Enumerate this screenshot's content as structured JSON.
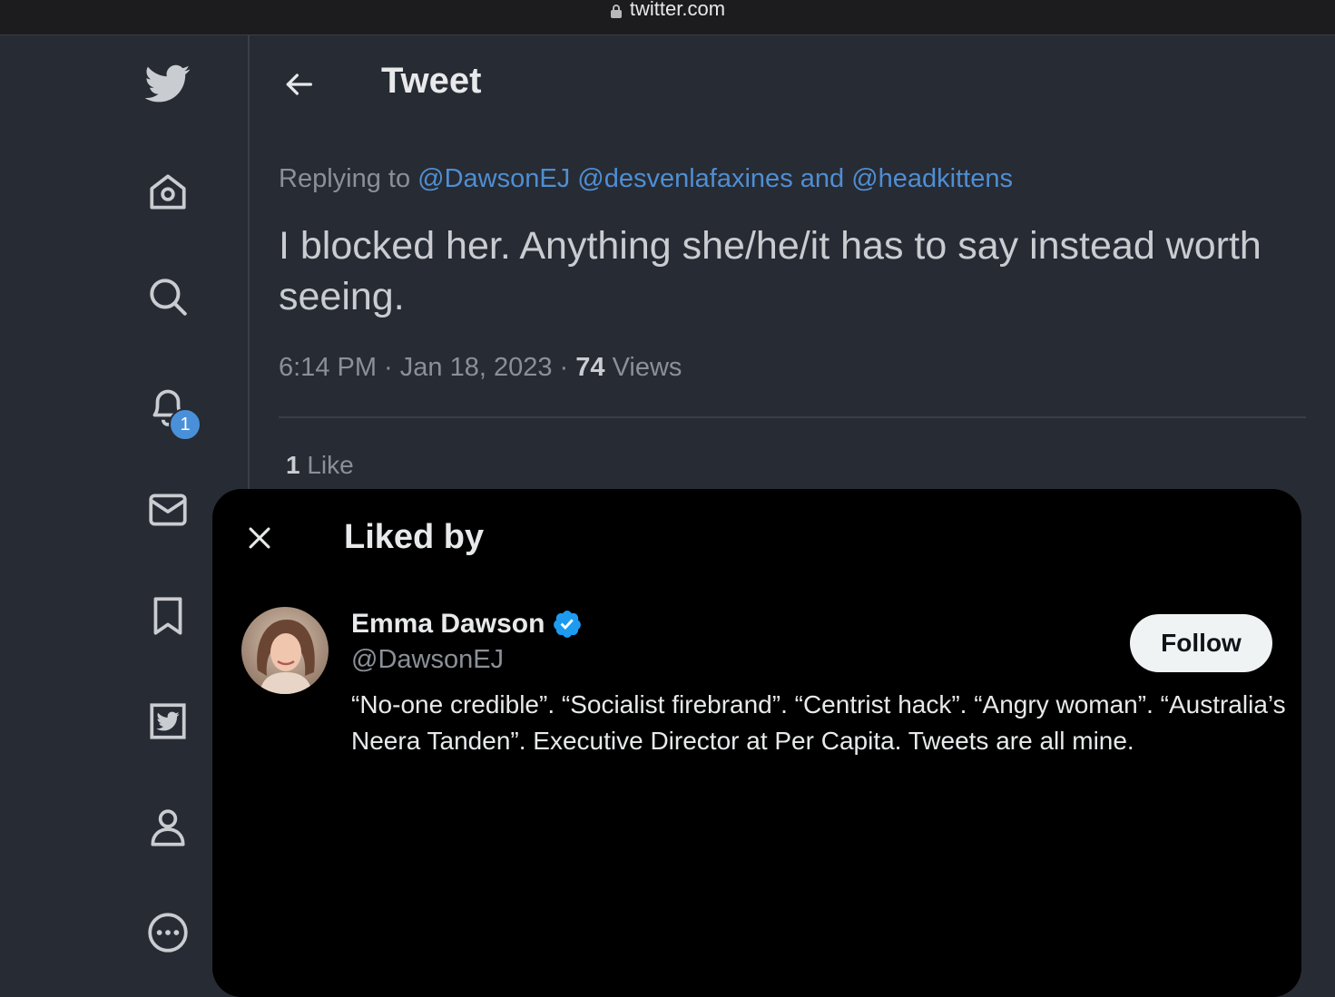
{
  "browser": {
    "url": "twitter.com"
  },
  "sidebar": {
    "items": [
      {
        "icon": "twitter-logo-icon"
      },
      {
        "icon": "home-icon"
      },
      {
        "icon": "search-icon"
      },
      {
        "icon": "notifications-icon",
        "badge": "1"
      },
      {
        "icon": "messages-icon"
      },
      {
        "icon": "bookmarks-icon"
      },
      {
        "icon": "twitter-blue-icon"
      },
      {
        "icon": "profile-icon"
      },
      {
        "icon": "more-icon"
      }
    ]
  },
  "header": {
    "title": "Tweet"
  },
  "tweet": {
    "replying_prefix": "Replying to ",
    "mention_1": "@DawsonEJ",
    "mention_2": "@desvenlafaxines",
    "and_word": "and",
    "mention_3": "@headkittens",
    "text": "I blocked her. Anything she/he/it has to say instead worth seeing.",
    "time": "6:14 PM · Jan 18, 2023 · ",
    "views_count": "74",
    "views_label": "Views",
    "likes_count": "1",
    "likes_label": "Like"
  },
  "modal": {
    "title": "Liked by",
    "user": {
      "name": "Emma Dawson",
      "handle": "@DawsonEJ",
      "bio": "“No-one credible”. “Socialist firebrand”. “Centrist hack”. “Angry woman”. “Australia’s Neera Tanden”. Executive Director at Per Capita. Tweets are all mine.",
      "follow_label": "Follow"
    }
  },
  "colors": {
    "accent": "#4f8ed3",
    "verified": "#1d9bf0",
    "background": "#272b33",
    "modal": "#000000"
  }
}
